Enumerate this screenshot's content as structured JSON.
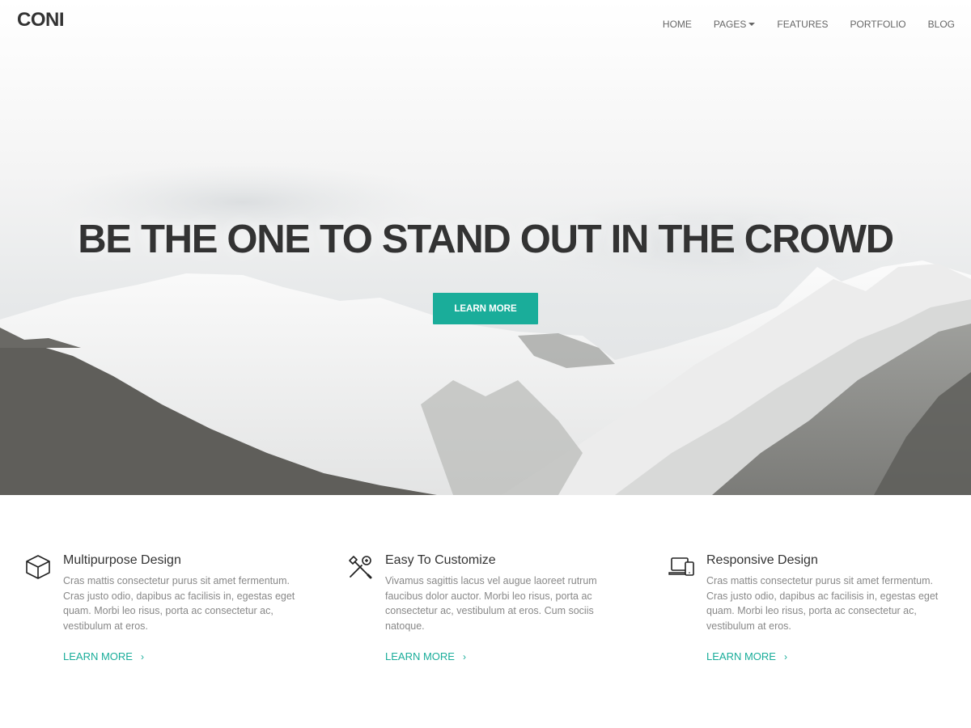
{
  "header": {
    "logo": "CONI",
    "nav": [
      {
        "label": "HOME"
      },
      {
        "label": "PAGES",
        "dropdown": true
      },
      {
        "label": "FEATURES"
      },
      {
        "label": "PORTFOLIO"
      },
      {
        "label": "BLOG"
      }
    ]
  },
  "hero": {
    "title": "BE THE ONE TO STAND OUT IN THE CROWD",
    "button": "LEARN MORE",
    "background": "snowy-mountains-image"
  },
  "features": [
    {
      "icon": "cube-icon",
      "title": "Multipurpose Design",
      "text": "Cras mattis consectetur purus sit amet fermentum. Cras justo odio, dapibus ac facilisis in, egestas eget quam. Morbi leo risus, porta ac consectetur ac, vestibulum at eros.",
      "link": "LEARN MORE"
    },
    {
      "icon": "tools-icon",
      "title": "Easy To Customize",
      "text": "Vivamus sagittis lacus vel augue laoreet rutrum faucibus dolor auctor. Morbi leo risus, porta ac consectetur ac, vestibulum at eros. Cum sociis natoque.",
      "link": "LEARN MORE"
    },
    {
      "icon": "devices-icon",
      "title": "Responsive Design",
      "text": "Cras mattis consectetur purus sit amet fermentum. Cras justo odio, dapibus ac facilisis in, egestas eget quam. Morbi leo risus, porta ac consectetur ac, vestibulum at eros.",
      "link": "LEARN MORE"
    }
  ],
  "colors": {
    "accent": "#1aad9a",
    "heading": "#333333",
    "body_text": "#888888",
    "nav_text": "#666666"
  }
}
